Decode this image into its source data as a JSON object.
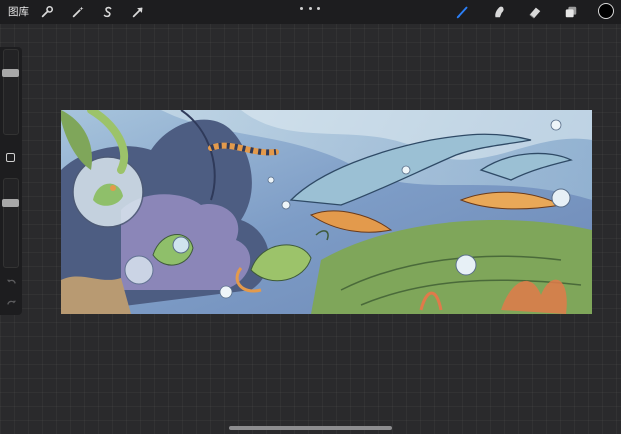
{
  "topbar": {
    "gallery_label": "图库",
    "tools_left": [
      {
        "name": "actions",
        "icon": "wrench-icon"
      },
      {
        "name": "adjustments",
        "icon": "magic-wand-icon"
      },
      {
        "name": "selection",
        "icon": "selection-s-icon"
      },
      {
        "name": "transform",
        "icon": "arrow-cursor-icon"
      }
    ],
    "more_icon": "more-dots-icon",
    "tools_right": [
      {
        "name": "brush",
        "icon": "brush-icon",
        "active": true
      },
      {
        "name": "smudge",
        "icon": "smudge-icon",
        "active": false
      },
      {
        "name": "eraser",
        "icon": "eraser-icon",
        "active": false
      },
      {
        "name": "layers",
        "icon": "layers-icon",
        "active": false
      }
    ],
    "current_color": "#000000",
    "active_tool_color": "#2b7ff6"
  },
  "sidebar": {
    "brush_size_level": 0.75,
    "opacity_level": 0.75,
    "modify_icon": "square-icon",
    "undo_icon": "undo-icon",
    "redo_icon": "redo-icon"
  },
  "canvas": {
    "artwork": "underwater-dragons-illustration",
    "palette": {
      "sky": "#7c9ec4",
      "water_light": "#a9c6dc",
      "creature_blue": "#9bc0d4",
      "dark_wave": "#4a5c7e",
      "purple": "#8a84b8",
      "orange": "#e39a4c",
      "green": "#9cc36a",
      "sand": "#b89a72",
      "cloud": "#8a8fa6"
    }
  }
}
